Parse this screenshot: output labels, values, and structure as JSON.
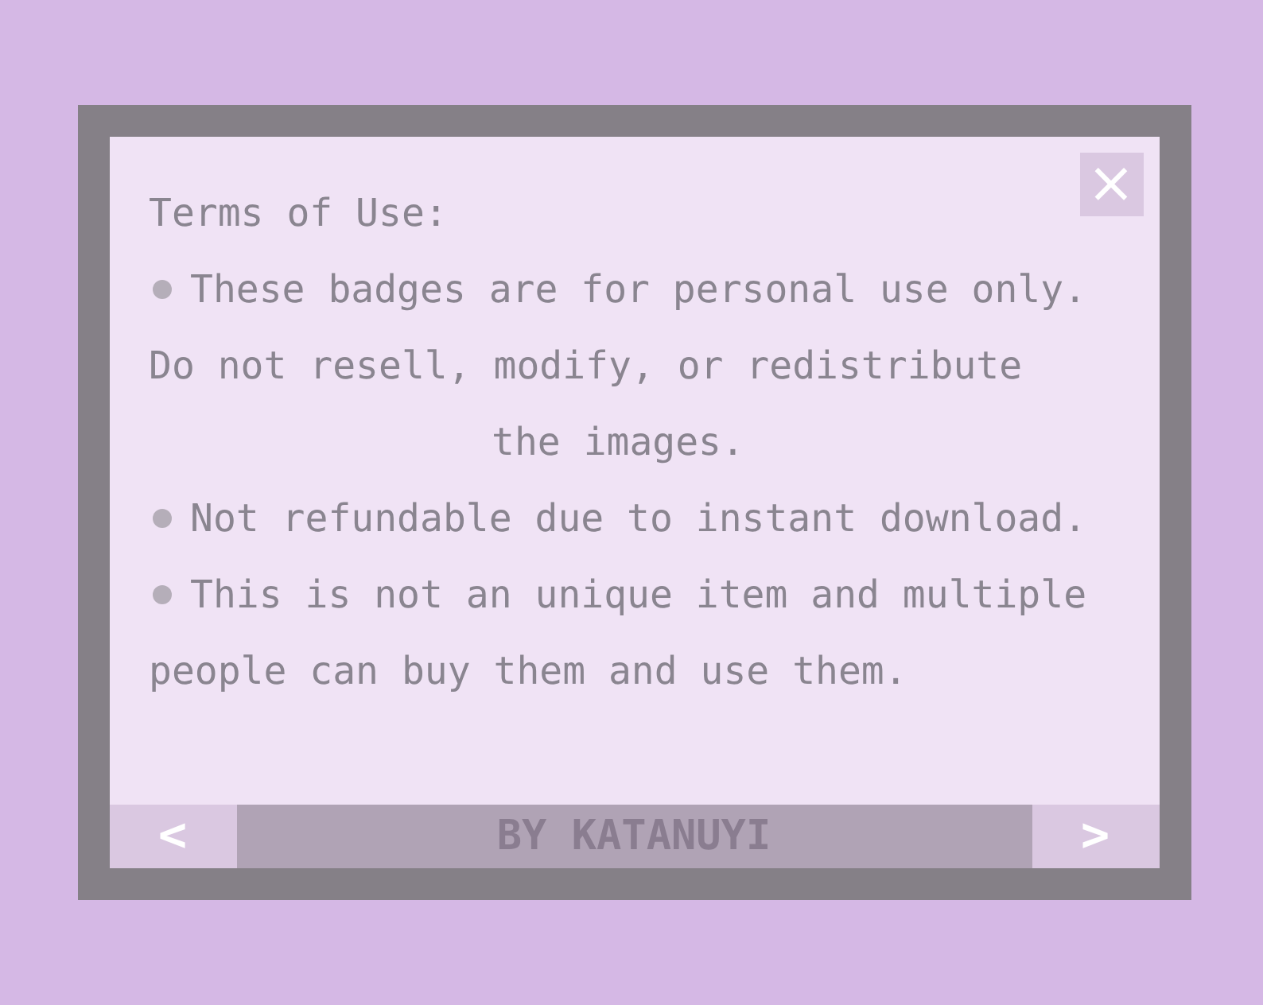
{
  "dialog": {
    "close_icon": "×",
    "lines": [
      {
        "text": "Terms of Use:",
        "bullet": false,
        "centered": false
      },
      {
        "text": "These badges are for personal use only.",
        "bullet": true,
        "centered": false
      },
      {
        "text": "Do not resell, modify, or redistribute",
        "bullet": false,
        "centered": false
      },
      {
        "text": "the images.",
        "bullet": false,
        "centered": true
      },
      {
        "text": "Not refundable due to instant download.",
        "bullet": true,
        "centered": false
      },
      {
        "text": "This is not an unique item and multiple",
        "bullet": true,
        "centered": false
      },
      {
        "text": "people can buy them and use them.",
        "bullet": false,
        "centered": false
      }
    ],
    "footer": {
      "prev": "<",
      "credit": "BY KATANUYI",
      "next": ">"
    }
  }
}
